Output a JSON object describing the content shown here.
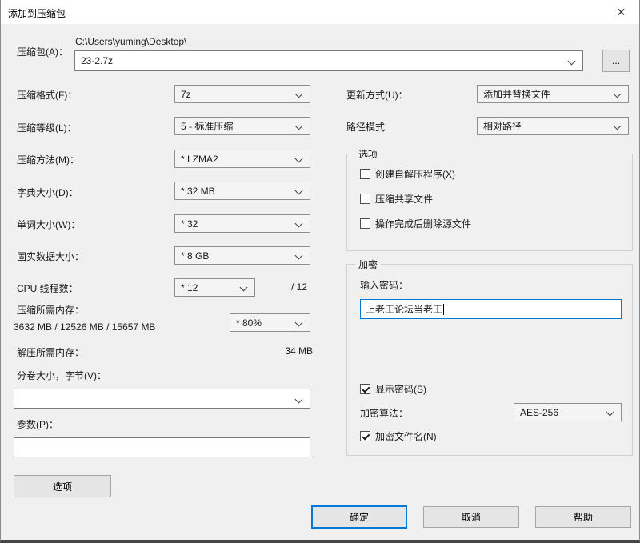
{
  "window": {
    "title": "添加到压缩包",
    "close_icon": "✕"
  },
  "archive": {
    "label": "压缩包(A)：",
    "path": "C:\\Users\\yuming\\Desktop\\",
    "name": "23-2.7z",
    "browse_label": "..."
  },
  "left": {
    "rows": [
      {
        "label": "压缩格式(F)：",
        "value": "7z"
      },
      {
        "label": "压缩等级(L)：",
        "value": "5 - 标准压缩"
      },
      {
        "label": "压缩方法(M)：",
        "value": "* LZMA2"
      },
      {
        "label": "字典大小(D)：",
        "value": "* 32 MB"
      },
      {
        "label": "单词大小(W)：",
        "value": "* 32"
      },
      {
        "label": "固实数据大小：",
        "value": "* 8 GB"
      }
    ],
    "cpu": {
      "label": "CPU 线程数：",
      "value": "* 12",
      "suffix": "/ 12"
    },
    "mem_compress": {
      "label": "压缩所需内存：",
      "detail": "3632 MB / 12526 MB / 15657 MB",
      "percent": "* 80%"
    },
    "mem_decompress": {
      "label": "解压所需内存：",
      "value": "34 MB"
    },
    "volume": {
      "label": "分卷大小，字节(V)：",
      "value": ""
    },
    "params": {
      "label": "参数(P)：",
      "value": ""
    },
    "options_button": "选项"
  },
  "right": {
    "update_mode": {
      "label": "更新方式(U)：",
      "value": "添加并替换文件"
    },
    "path_mode": {
      "label": "路径模式",
      "value": "相对路径"
    },
    "options_group": {
      "title": "选项",
      "checkboxes": [
        {
          "label": "创建自解压程序(X)",
          "checked": false
        },
        {
          "label": "压缩共享文件",
          "checked": false
        },
        {
          "label": "操作完成后删除源文件",
          "checked": false
        }
      ]
    },
    "encryption_group": {
      "title": "加密",
      "password_label": "输入密码：",
      "password_value": "上老王论坛当老王",
      "show_password": {
        "label": "显示密码(S)",
        "checked": true
      },
      "algorithm": {
        "label": "加密算法：",
        "value": "AES-256"
      },
      "encrypt_names": {
        "label": "加密文件名(N)",
        "checked": true
      }
    }
  },
  "footer": {
    "ok": "确定",
    "cancel": "取消",
    "help": "帮助"
  },
  "colors": {
    "accent": "#0078d7",
    "dialog_bg": "#f0f0f0",
    "titlebar_bg": "#ffffff"
  }
}
